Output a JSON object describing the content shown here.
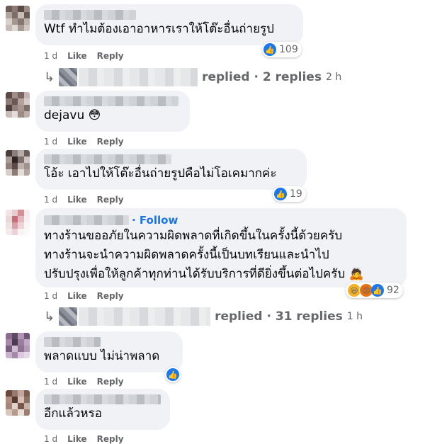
{
  "comments": [
    {
      "text_lines": [
        "Wtf ทำไมต้องเอาอาหารเราให้โต๊ะอื่นถ่ายรูป"
      ],
      "time": "1 d",
      "like": "Like",
      "reply": "Reply",
      "reaction_count": "109",
      "replies": {
        "text": "replied · 2 replies",
        "time": "2 h"
      }
    },
    {
      "text_lines": [
        "dejavu 😳"
      ],
      "time": "1 d",
      "like": "Like",
      "reply": "Reply"
    },
    {
      "text_lines": [
        "โอ้ะ เอาไปให้โต๊ะอื่นถ่ายรูปคือไม่โอเคมากค่ะ"
      ],
      "time": "1 d",
      "like": "Like",
      "reply": "Reply",
      "reaction_count": "19"
    },
    {
      "follow": "· Follow",
      "text_lines": [
        "ทางร้านขออภัยในความผิดพลาดที่เกิดขึ้นในครั้งนี้ด้วยครับ",
        "ทางร้านจะนำความผิดพลาดครั้งนี้เป็นบทเรียนและนำไป",
        "ปรับปรุงเพื่อให้ลูกค้าทุกท่านได้รับบริการที่ดียิ่งขึ้นต่อไปครับ 🙇"
      ],
      "time": "1 d",
      "like": "Like",
      "reply": "Reply",
      "reaction_count": "92",
      "replies": {
        "text": "replied · 31 replies",
        "time": "1 h"
      }
    },
    {
      "text_lines": [
        "พลาดแบบ ไม่น่าพลาด"
      ],
      "time": "1 d",
      "like": "Like",
      "reply": "Reply"
    },
    {
      "text_lines": [
        "อีกแล้วหรอ"
      ],
      "time": "1 d",
      "like": "Like",
      "reply": "Reply"
    }
  ],
  "colors": {
    "accent": "#1877f2",
    "bubble": "#f0f2f5",
    "meta": "#65676b"
  },
  "icons": {
    "like": "thumbs-up-icon",
    "haha": "haha-emoji-icon",
    "angry": "angry-emoji-icon",
    "reply_arrow": "reply-arrow-icon"
  }
}
